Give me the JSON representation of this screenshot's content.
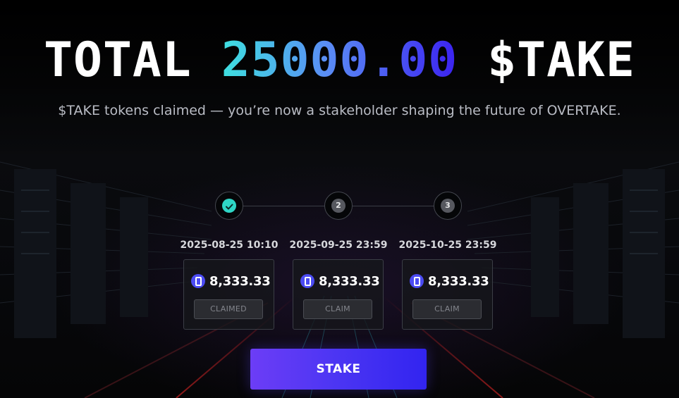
{
  "hero": {
    "title_prefix": "TOTAL ",
    "title_amount": "25000.00",
    "title_suffix": " $TAKE",
    "subtitle": "$TAKE tokens claimed — you’re now a stakeholder shaping the future of OVERTAKE."
  },
  "steps": [
    {
      "label": "",
      "status": "done",
      "icon": "check-icon"
    },
    {
      "label": "2",
      "status": "pending"
    },
    {
      "label": "3",
      "status": "pending"
    }
  ],
  "vesting": [
    {
      "date": "2025-08-25 10:10",
      "amount": "8,333.33",
      "button": "CLAIMED",
      "icon": "overtake-token-icon"
    },
    {
      "date": "2025-09-25 23:59",
      "amount": "8,333.33",
      "button": "CLAIM",
      "icon": "overtake-token-icon"
    },
    {
      "date": "2025-10-25 23:59",
      "amount": "8,333.33",
      "button": "CLAIM",
      "icon": "overtake-token-icon"
    }
  ],
  "actions": {
    "stake_label": "STAKE"
  },
  "colors": {
    "accent_start": "#6c3df6",
    "accent_end": "#3224f0",
    "amount_gradient_start": "#3ee0e0",
    "amount_gradient_end": "#3b22f0",
    "step_done": "#2ed6c6",
    "token": "#4b4bf3"
  }
}
